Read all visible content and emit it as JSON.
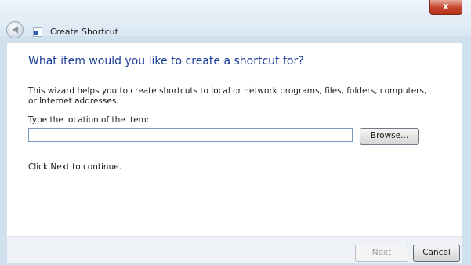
{
  "window": {
    "title": "Create Shortcut",
    "close_glyph": "x",
    "back_icon": "back-arrow-icon",
    "app_icon": "shortcut-icon"
  },
  "content": {
    "heading": "What item would you like to create a shortcut for?",
    "intro": "This wizard helps you to create shortcuts to local or network programs, files, folders, computers, or Internet addresses.",
    "location_label": "Type the location of the item:",
    "location_value": "",
    "browse_label": "Browse...",
    "continue_text": "Click Next to continue."
  },
  "footer": {
    "next_label": "Next",
    "cancel_label": "Cancel"
  },
  "colors": {
    "heading": "#1b3c95",
    "frame": "#cfe0ee",
    "close": "#c5442c"
  }
}
